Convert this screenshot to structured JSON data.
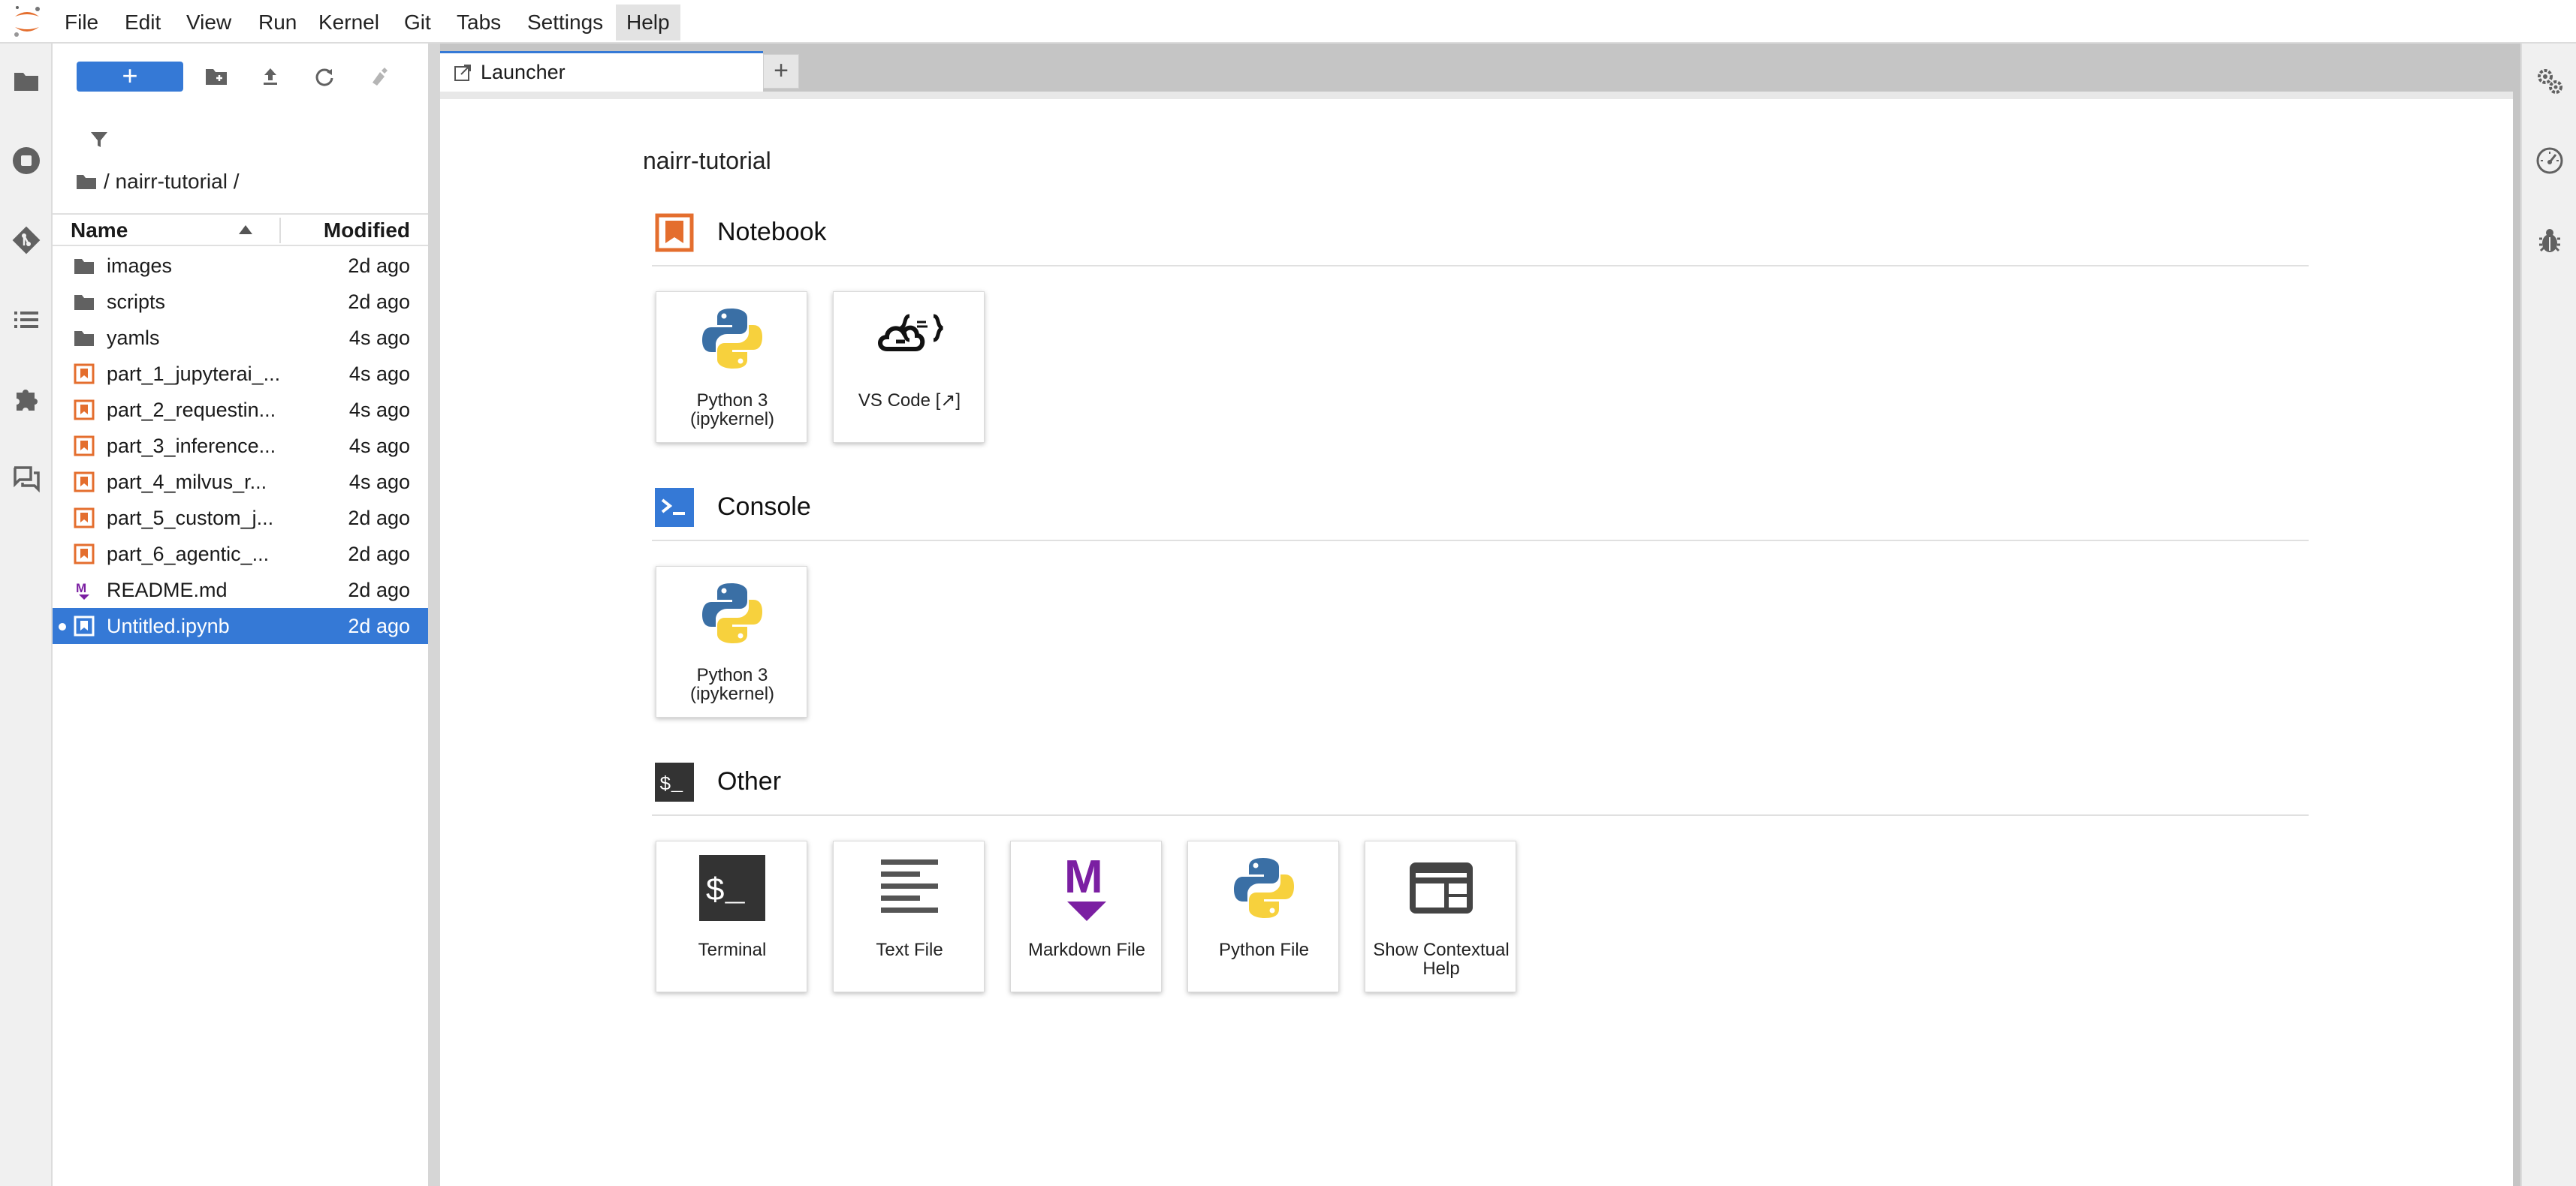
{
  "menu": {
    "items": [
      "File",
      "Edit",
      "View",
      "Run",
      "Kernel",
      "Git",
      "Tabs",
      "Settings",
      "Help"
    ],
    "active": "Help"
  },
  "activity_bar": {
    "icons": [
      "folder-icon",
      "running-stop-icon",
      "git-icon",
      "table-of-contents-icon",
      "extension-icon",
      "chat-icon"
    ]
  },
  "file_browser": {
    "new_label": "+",
    "breadcrumb": "/ nairr-tutorial /",
    "columns": {
      "name": "Name",
      "modified": "Modified"
    },
    "files": [
      {
        "name": "images",
        "modified": "2d ago",
        "type": "folder"
      },
      {
        "name": "scripts",
        "modified": "2d ago",
        "type": "folder"
      },
      {
        "name": "yamls",
        "modified": "4s ago",
        "type": "folder"
      },
      {
        "name": "part_1_jupyterai_...",
        "modified": "4s ago",
        "type": "notebook"
      },
      {
        "name": "part_2_requestin...",
        "modified": "4s ago",
        "type": "notebook"
      },
      {
        "name": "part_3_inference...",
        "modified": "4s ago",
        "type": "notebook"
      },
      {
        "name": "part_4_milvus_r...",
        "modified": "4s ago",
        "type": "notebook"
      },
      {
        "name": "part_5_custom_j...",
        "modified": "2d ago",
        "type": "notebook"
      },
      {
        "name": "part_6_agentic_...",
        "modified": "2d ago",
        "type": "notebook"
      },
      {
        "name": "README.md",
        "modified": "2d ago",
        "type": "markdown"
      },
      {
        "name": "Untitled.ipynb",
        "modified": "2d ago",
        "type": "notebook",
        "selected": true
      }
    ]
  },
  "tabs": {
    "launcher_label": "Launcher",
    "add_label": "+"
  },
  "launcher": {
    "cwd": "nairr-tutorial",
    "sections": {
      "notebook": {
        "title": "Notebook",
        "cards": [
          {
            "label": "Python 3 (ipykernel)",
            "icon": "python-icon"
          },
          {
            "label": "VS Code [↗]",
            "icon": "vscode-cloud-icon"
          }
        ]
      },
      "console": {
        "title": "Console",
        "cards": [
          {
            "label": "Python 3 (ipykernel)",
            "icon": "python-icon"
          }
        ]
      },
      "other": {
        "title": "Other",
        "cards": [
          {
            "label": "Terminal",
            "icon": "terminal-icon"
          },
          {
            "label": "Text File",
            "icon": "text-file-icon"
          },
          {
            "label": "Markdown File",
            "icon": "markdown-icon"
          },
          {
            "label": "Python File",
            "icon": "python-icon"
          },
          {
            "label": "Show Contextual Help",
            "icon": "contextual-help-icon"
          }
        ]
      }
    }
  },
  "colors": {
    "accent": "#3579d6",
    "notebook_orange": "#e46e2e",
    "markdown_purple": "#7b1fa2",
    "python_blue": "#3a6fa5",
    "python_yellow": "#f7d13d"
  }
}
